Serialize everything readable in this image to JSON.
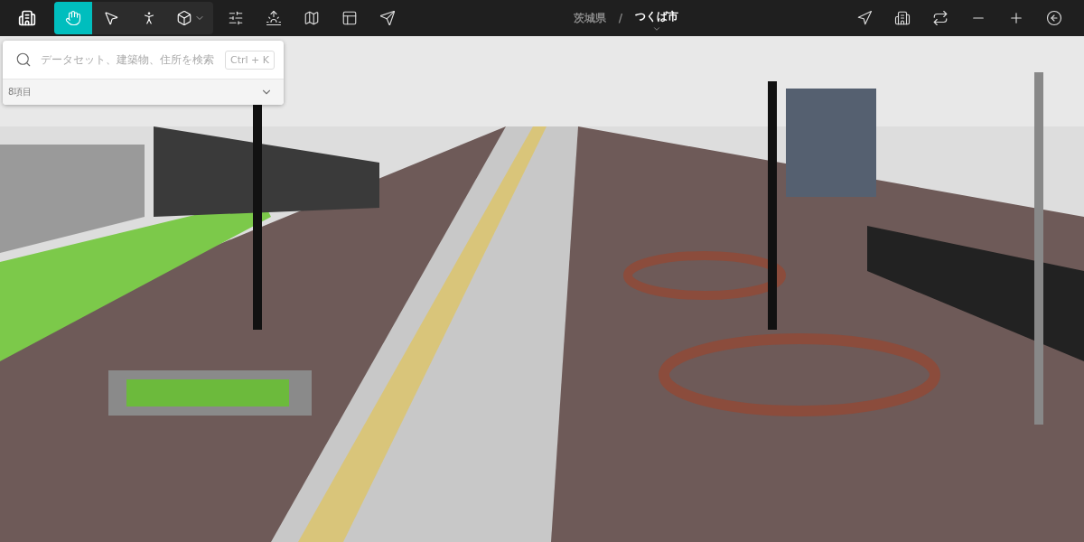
{
  "toolbar": {
    "tools": [
      {
        "selected": true
      },
      {
        "selected": false
      },
      {
        "selected": false
      },
      {
        "selected": false,
        "kind": "dropdown"
      }
    ]
  },
  "breadcrumb": {
    "prefecture": "茨城県",
    "separator": "/",
    "city": "つくば市"
  },
  "search": {
    "placeholder": "データセット、建築物、住所を検索",
    "shortcut": "Ctrl + K",
    "count": "8項目"
  }
}
